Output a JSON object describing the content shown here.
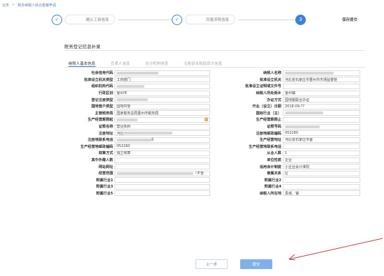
{
  "breadcrumb": {
    "home": "业务",
    "sep": ">",
    "current": "新办纳税人综合套餐申请"
  },
  "steps": [
    {
      "num": "✓",
      "label": "确认工商信息",
      "active": false
    },
    {
      "num": "✓",
      "label": "完善涉税信息",
      "active": false
    },
    {
      "num": "3",
      "label": "保存提交",
      "active": true
    }
  ],
  "section_title": "税务登记信息补录",
  "tabs": [
    "纳税人基本信息",
    "负责人信息",
    "总分机构信息",
    "注册资本和投资方信息"
  ],
  "rows": [
    {
      "l_label": "社会信用代码",
      "l_value": "",
      "l_blur": 60,
      "r_label": "纳税人名称",
      "r_value": "",
      "r_blur": 70
    },
    {
      "l_label": "批准设立机关类型",
      "l_value": "工商部门",
      "r_label": "批准设立机关",
      "r_value": "河北省石家庄市晋州市市场监督管"
    },
    {
      "l_label": "组织机构代码",
      "l_value": "",
      "l_blur": 40,
      "r_label": "批准设立证明或文件号",
      "r_value": ""
    },
    {
      "l_label": "行政区划",
      "l_value": "晋州市",
      "r_label": "纳税人所处街乡",
      "r_value": "晋州镇"
    },
    {
      "l_label": "登记注册类型",
      "l_value": "",
      "l_blur": 45,
      "r_label": "办证方式",
      "r_value": "国地税联合办证"
    },
    {
      "l_label": "国地管户类型",
      "l_value": "国地共管",
      "r_label": "开业（设立）日期",
      "r_value": "2018-09-??"
    },
    {
      "l_label": "主管税务局",
      "l_value": "国家税务总局晋州市税务局",
      "r_label": "国标行业（主）",
      "r_value": "",
      "r_blur": 55
    },
    {
      "l_label": "生产经营期限起",
      "l_value": "",
      "l_blur": 30,
      "r_label": "生产经营期限止",
      "r_value": ""
    },
    {
      "l_label": "证照名称",
      "l_value": "营业执照",
      "r_label": "证照号码",
      "r_value": "",
      "r_blur": 50
    },
    {
      "l_label": "注册地址",
      "l_value": "河北",
      "l_blur": 70,
      "r_label": "注册地邮政编码",
      "r_value": "052260"
    },
    {
      "l_label": "注册地联系电话",
      "l_value": "6",
      "l_blur": 50,
      "r_label": "生产经营地址",
      "r_value": "河北省石家庄市晋"
    },
    {
      "l_label": "生产经营地邮政编码",
      "l_value": "052260",
      "r_label": "生产经营地联系电话",
      "r_value": ""
    },
    {
      "l_label": "核算方式",
      "l_value": "独立核算",
      "r_label": "从业人数",
      "r_value": "1"
    },
    {
      "l_label": "其中外籍人数",
      "l_value": "",
      "r_label": "单位性质",
      "r_value": "企业"
    },
    {
      "l_label": "网站网址",
      "l_value": "",
      "r_label": "适用会计制度",
      "r_value": "小企业会计准则"
    },
    {
      "l_label": "经营范围",
      "l_value": "（不含",
      "l_blur": 110,
      "r_label": "隶属关系",
      "r_value": "区"
    },
    {
      "l_label": "附属行业1",
      "l_value": "",
      "r_label": "附属行业2",
      "r_value": ""
    },
    {
      "l_label": "附属行业3",
      "l_value": "",
      "r_label": "附属行业4",
      "r_value": ""
    },
    {
      "l_label": "附属行业5",
      "l_value": "",
      "r_label": "纳税人所在地",
      "r_value": "县城、镇"
    }
  ],
  "buttons": {
    "prev": "上一步",
    "submit": "提交"
  },
  "colors": {
    "accent": "#3b82e0",
    "annotation": "#d23b3b"
  }
}
